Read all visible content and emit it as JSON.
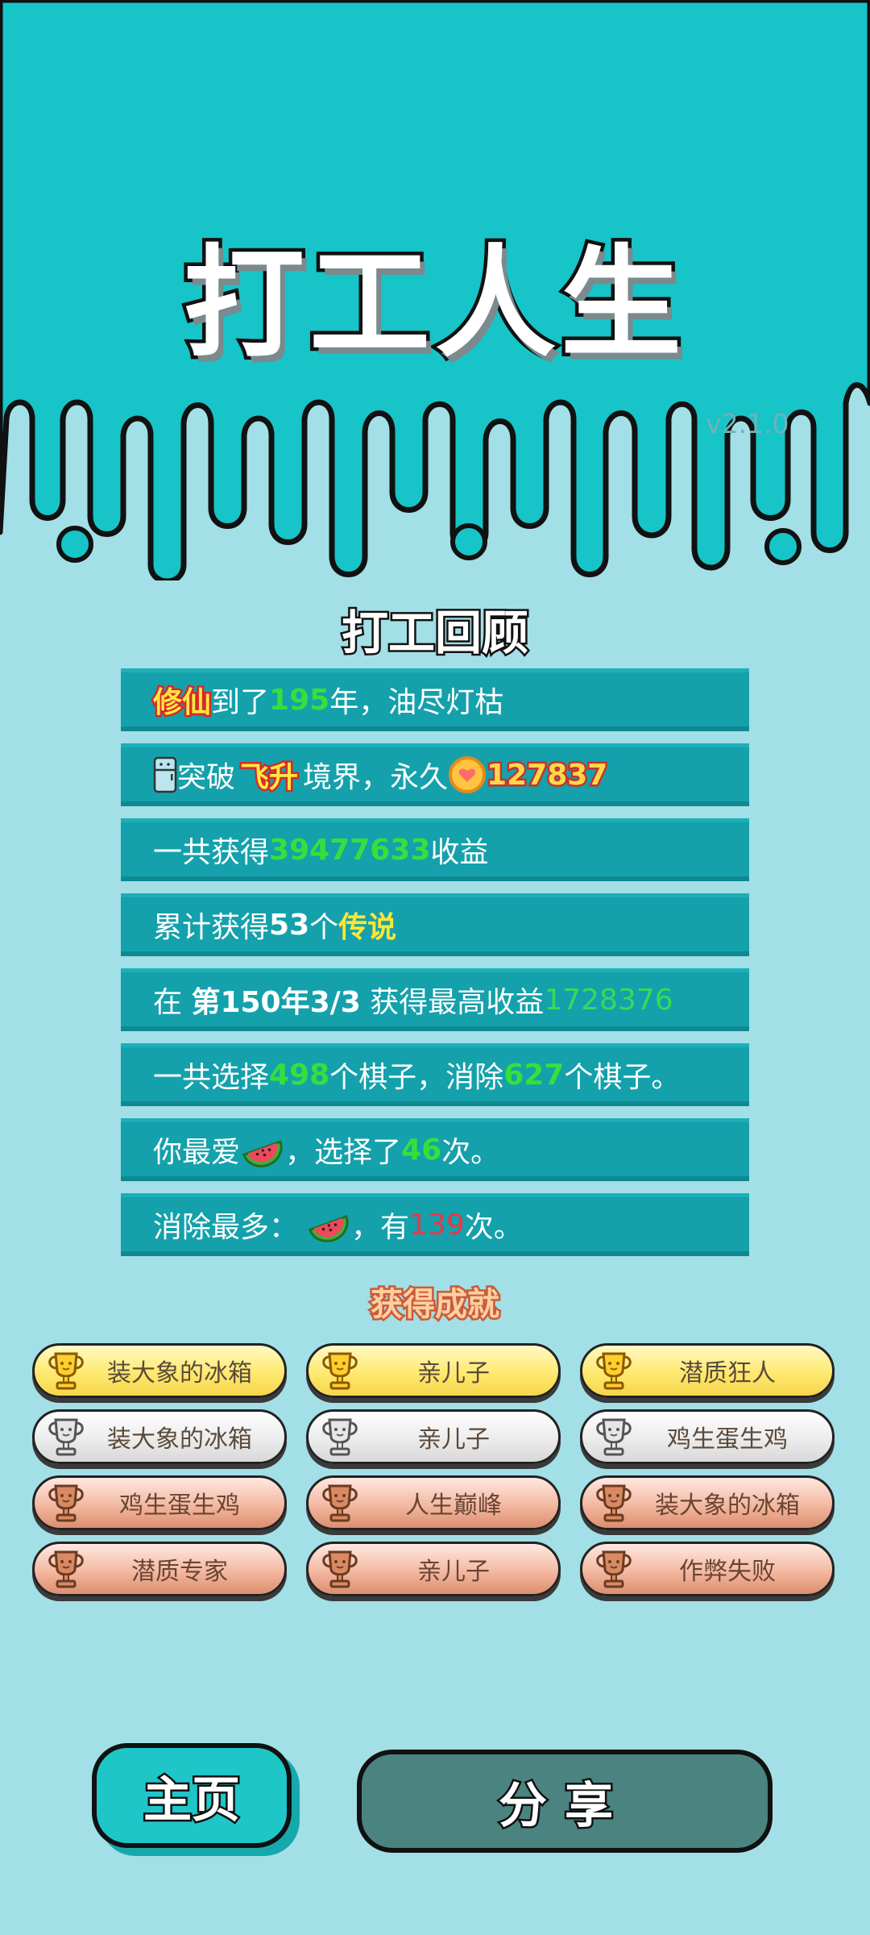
{
  "header": {
    "title": "打工人生",
    "version": "v2.1.0"
  },
  "review": {
    "title": "打工回顾",
    "rows": [
      {
        "a": "修仙",
        "b": "到了",
        "c": "195",
        "d": "年，油尽灯枯"
      },
      {
        "a": "突破",
        "b": "飞升",
        "c": "境界，永久",
        "d": "127837"
      },
      {
        "a": "一共获得",
        "b": "39477633",
        "c": "收益"
      },
      {
        "a": "累计获得",
        "b": "53",
        "c": "个",
        "d": "传说"
      },
      {
        "a": "在 ",
        "b": "第150年3/3",
        "c": " 获得最高收益",
        "d": "1728376"
      },
      {
        "a": "一共选择",
        "b": "498",
        "c": "个棋子，消除",
        "d": "627",
        "e": "个棋子。"
      },
      {
        "a": "你最爱",
        "b": "，选择了",
        "c": "46",
        "d": "次。"
      },
      {
        "a": "消除最多：",
        "b": "，有",
        "c": "139",
        "d": "次。"
      }
    ]
  },
  "achievements": {
    "title": "获得成就",
    "items": [
      {
        "label": "装大象的冰箱",
        "tier": "gold"
      },
      {
        "label": "亲儿子",
        "tier": "gold"
      },
      {
        "label": "潜质狂人",
        "tier": "gold"
      },
      {
        "label": "装大象的冰箱",
        "tier": "silver"
      },
      {
        "label": "亲儿子",
        "tier": "silver"
      },
      {
        "label": "鸡生蛋生鸡",
        "tier": "silver"
      },
      {
        "label": "鸡生蛋生鸡",
        "tier": "bronze"
      },
      {
        "label": "人生巅峰",
        "tier": "bronze"
      },
      {
        "label": "装大象的冰箱",
        "tier": "bronze"
      },
      {
        "label": "潜质专家",
        "tier": "bronze"
      },
      {
        "label": "亲儿子",
        "tier": "bronze"
      },
      {
        "label": "作弊失败",
        "tier": "bronze"
      }
    ]
  },
  "buttons": {
    "home": "主页",
    "share": "分享"
  },
  "colors": {
    "top_bg": "#17c4c8",
    "page_bg": "#a3dfe6",
    "row_bg": "#14a1ab",
    "highlight_green": "#35e03c",
    "highlight_yellow": "#ffe636",
    "highlight_red": "#e8384a"
  },
  "icons": {
    "fridge": "fridge-icon",
    "coin": "heart-coin-icon",
    "fruit": "watermelon-icon",
    "trophy": "trophy-icon"
  }
}
